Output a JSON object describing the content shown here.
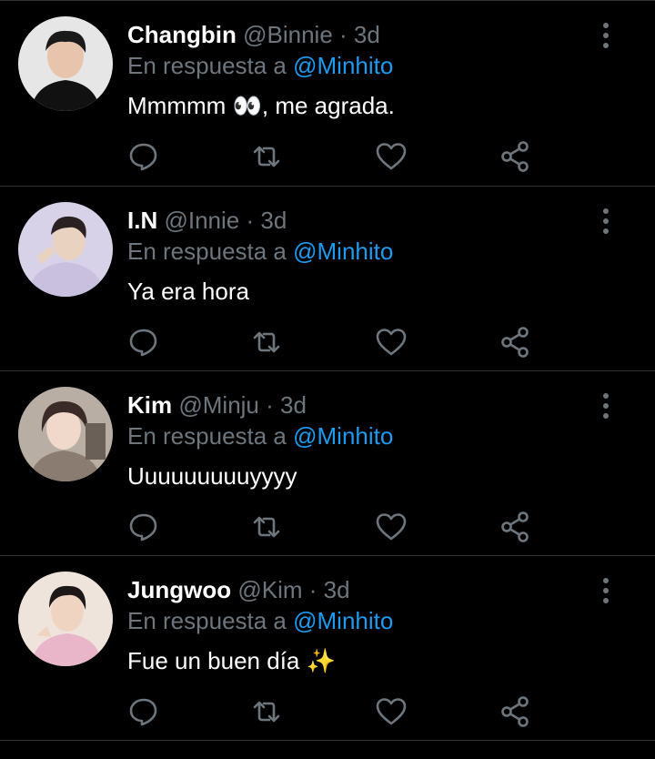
{
  "replies": [
    {
      "name": "Changbin",
      "handle": "@Binnie",
      "time": "3d",
      "reply_prefix": "En respuesta a",
      "mention": "@Minhito",
      "text": "Mmmmm 👀, me agrada.",
      "avatar_bg": "#d9d9d9"
    },
    {
      "name": "I.N",
      "handle": "@Innie",
      "time": "3d",
      "reply_prefix": "En respuesta a",
      "mention": "@Minhito",
      "text": "Ya era hora",
      "avatar_bg": "#cfc8e6"
    },
    {
      "name": "Kim",
      "handle": "@Minju",
      "time": "3d",
      "reply_prefix": "En respuesta a",
      "mention": "@Minhito",
      "text": "Uuuuuuuuuyyyy",
      "avatar_bg": "#bfb6ad"
    },
    {
      "name": "Jungwoo",
      "handle": "@Kim",
      "time": "3d",
      "reply_prefix": "En respuesta a",
      "mention": "@Minhito",
      "text": "Fue un buen día ✨",
      "avatar_bg": "#e8d6cc"
    }
  ],
  "separator": "·",
  "icons": {
    "reply": "comment-icon",
    "retweet": "retweet-icon",
    "like": "heart-icon",
    "share": "share-icon",
    "more": "more-vertical-icon"
  },
  "colors": {
    "background": "#000000",
    "text": "#ffffff",
    "secondary": "#6e767d",
    "mention": "#1d9bf0",
    "divider": "#2f3336"
  }
}
